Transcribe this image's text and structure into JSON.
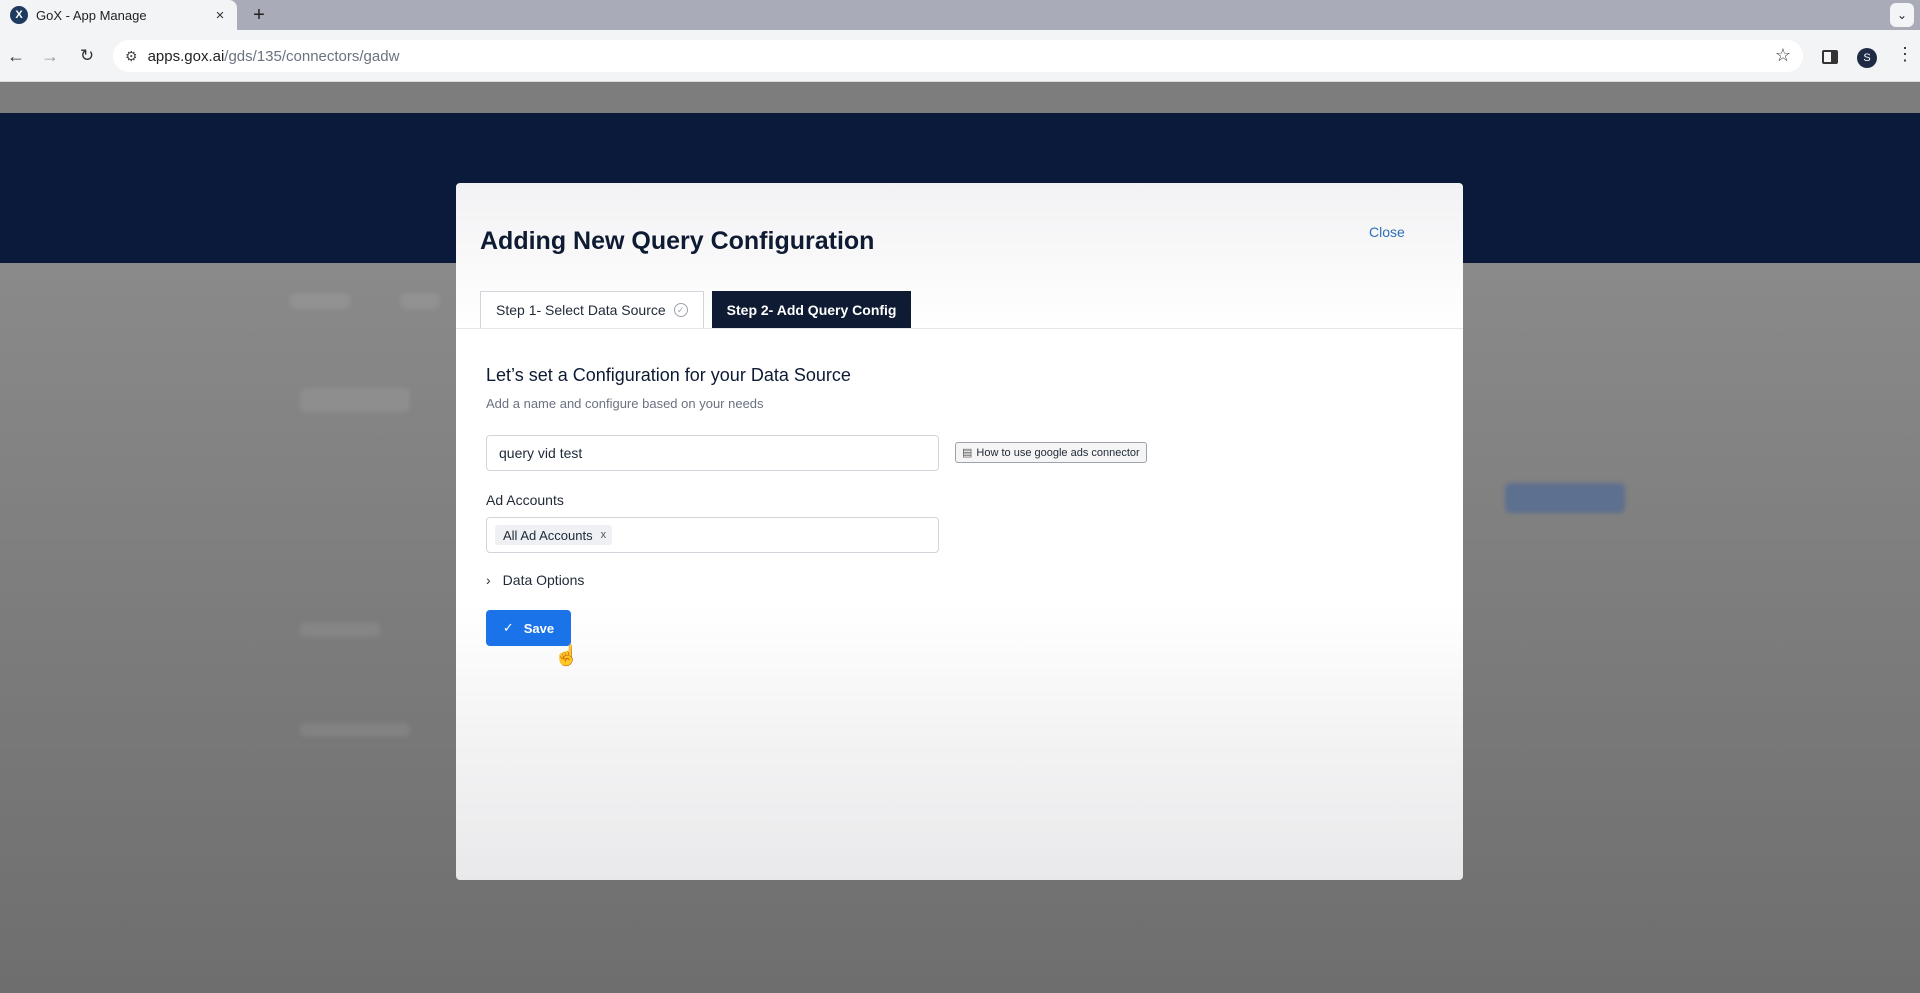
{
  "browser": {
    "tab_title": "GoX - App Manage",
    "tab_favicon": "X",
    "tab_close": "×",
    "new_tab": "+",
    "tabbar_menu": "⌄",
    "url_host": "apps.gox.ai",
    "url_path": "/gds/135/connectors/gadw",
    "profile_initial": "S",
    "icons": {
      "back": "←",
      "forward": "→",
      "reload": "↻",
      "site_info": "⚙",
      "star": "☆",
      "menu": "⋮"
    }
  },
  "modal": {
    "title": "Adding New Query Configuration",
    "close_label": "Close",
    "steps": [
      {
        "label": "Step 1- Select Data Source",
        "completed": true
      },
      {
        "label": "Step 2- Add Query Config",
        "active": true
      }
    ],
    "section_title": "Let’s set a Configuration for your Data Source",
    "section_subtitle": "Add a name and configure based on your needs",
    "name_value": "query vid test",
    "help_link_label": "How to use google ads connector",
    "ad_accounts_label": "Ad Accounts",
    "ad_accounts_chip": "All Ad Accounts",
    "chip_remove": "x",
    "data_options_label": "Data Options",
    "save_label": "Save"
  },
  "colors": {
    "primary": "#1a73e8",
    "navy": "#0e1b33",
    "link": "#2f6fb5"
  }
}
